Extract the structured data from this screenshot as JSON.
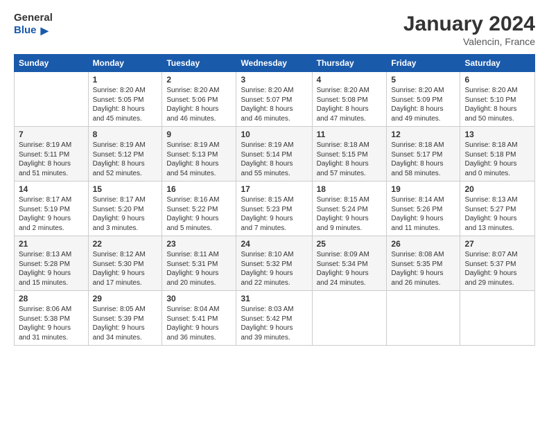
{
  "header": {
    "logo_general": "General",
    "logo_blue": "Blue",
    "title": "January 2024",
    "subtitle": "Valencin, France"
  },
  "columns": [
    "Sunday",
    "Monday",
    "Tuesday",
    "Wednesday",
    "Thursday",
    "Friday",
    "Saturday"
  ],
  "weeks": [
    [
      {
        "day": "",
        "info": ""
      },
      {
        "day": "1",
        "info": "Sunrise: 8:20 AM\nSunset: 5:05 PM\nDaylight: 8 hours\nand 45 minutes."
      },
      {
        "day": "2",
        "info": "Sunrise: 8:20 AM\nSunset: 5:06 PM\nDaylight: 8 hours\nand 46 minutes."
      },
      {
        "day": "3",
        "info": "Sunrise: 8:20 AM\nSunset: 5:07 PM\nDaylight: 8 hours\nand 46 minutes."
      },
      {
        "day": "4",
        "info": "Sunrise: 8:20 AM\nSunset: 5:08 PM\nDaylight: 8 hours\nand 47 minutes."
      },
      {
        "day": "5",
        "info": "Sunrise: 8:20 AM\nSunset: 5:09 PM\nDaylight: 8 hours\nand 49 minutes."
      },
      {
        "day": "6",
        "info": "Sunrise: 8:20 AM\nSunset: 5:10 PM\nDaylight: 8 hours\nand 50 minutes."
      }
    ],
    [
      {
        "day": "7",
        "info": ""
      },
      {
        "day": "8",
        "info": "Sunrise: 8:19 AM\nSunset: 5:12 PM\nDaylight: 8 hours\nand 52 minutes."
      },
      {
        "day": "9",
        "info": "Sunrise: 8:19 AM\nSunset: 5:13 PM\nDaylight: 8 hours\nand 54 minutes."
      },
      {
        "day": "10",
        "info": "Sunrise: 8:19 AM\nSunset: 5:14 PM\nDaylight: 8 hours\nand 55 minutes."
      },
      {
        "day": "11",
        "info": "Sunrise: 8:18 AM\nSunset: 5:15 PM\nDaylight: 8 hours\nand 57 minutes."
      },
      {
        "day": "12",
        "info": "Sunrise: 8:18 AM\nSunset: 5:17 PM\nDaylight: 8 hours\nand 58 minutes."
      },
      {
        "day": "13",
        "info": "Sunrise: 8:18 AM\nSunset: 5:18 PM\nDaylight: 9 hours\nand 0 minutes."
      }
    ],
    [
      {
        "day": "14",
        "info": ""
      },
      {
        "day": "15",
        "info": "Sunrise: 8:17 AM\nSunset: 5:20 PM\nDaylight: 9 hours\nand 3 minutes."
      },
      {
        "day": "16",
        "info": "Sunrise: 8:16 AM\nSunset: 5:22 PM\nDaylight: 9 hours\nand 5 minutes."
      },
      {
        "day": "17",
        "info": "Sunrise: 8:15 AM\nSunset: 5:23 PM\nDaylight: 9 hours\nand 7 minutes."
      },
      {
        "day": "18",
        "info": "Sunrise: 8:15 AM\nSunset: 5:24 PM\nDaylight: 9 hours\nand 9 minutes."
      },
      {
        "day": "19",
        "info": "Sunrise: 8:14 AM\nSunset: 5:26 PM\nDaylight: 9 hours\nand 11 minutes."
      },
      {
        "day": "20",
        "info": "Sunrise: 8:13 AM\nSunset: 5:27 PM\nDaylight: 9 hours\nand 13 minutes."
      }
    ],
    [
      {
        "day": "21",
        "info": ""
      },
      {
        "day": "22",
        "info": "Sunrise: 8:12 AM\nSunset: 5:30 PM\nDaylight: 9 hours\nand 17 minutes."
      },
      {
        "day": "23",
        "info": "Sunrise: 8:11 AM\nSunset: 5:31 PM\nDaylight: 9 hours\nand 20 minutes."
      },
      {
        "day": "24",
        "info": "Sunrise: 8:10 AM\nSunset: 5:32 PM\nDaylight: 9 hours\nand 22 minutes."
      },
      {
        "day": "25",
        "info": "Sunrise: 8:09 AM\nSunset: 5:34 PM\nDaylight: 9 hours\nand 24 minutes."
      },
      {
        "day": "26",
        "info": "Sunrise: 8:08 AM\nSunset: 5:35 PM\nDaylight: 9 hours\nand 26 minutes."
      },
      {
        "day": "27",
        "info": "Sunrise: 8:07 AM\nSunset: 5:37 PM\nDaylight: 9 hours\nand 29 minutes."
      }
    ],
    [
      {
        "day": "28",
        "info": "Sunrise: 8:06 AM\nSunset: 5:38 PM\nDaylight: 9 hours\nand 31 minutes."
      },
      {
        "day": "29",
        "info": "Sunrise: 8:05 AM\nSunset: 5:39 PM\nDaylight: 9 hours\nand 34 minutes."
      },
      {
        "day": "30",
        "info": "Sunrise: 8:04 AM\nSunset: 5:41 PM\nDaylight: 9 hours\nand 36 minutes."
      },
      {
        "day": "31",
        "info": "Sunrise: 8:03 AM\nSunset: 5:42 PM\nDaylight: 9 hours\nand 39 minutes."
      },
      {
        "day": "",
        "info": ""
      },
      {
        "day": "",
        "info": ""
      },
      {
        "day": "",
        "info": ""
      }
    ]
  ],
  "week7_sun_info": "Sunrise: 8:19 AM\nSunset: 5:11 PM\nDaylight: 8 hours\nand 51 minutes.",
  "week14_sun_info": "Sunrise: 8:17 AM\nSunset: 5:19 PM\nDaylight: 9 hours\nand 2 minutes.",
  "week21_sun_info": "Sunrise: 8:13 AM\nSunset: 5:28 PM\nDaylight: 9 hours\nand 15 minutes."
}
